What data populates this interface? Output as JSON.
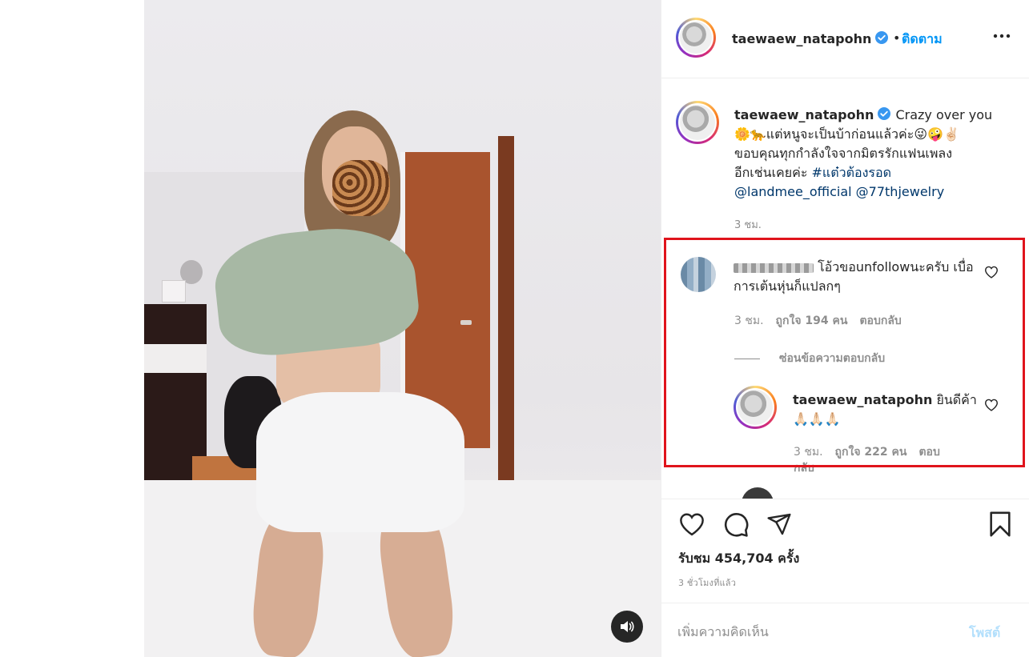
{
  "post": {
    "username": "taewaew_natapohn",
    "follow_dot": "•",
    "follow_label": "ติดตาม",
    "caption": {
      "username": "taewaew_natapohn",
      "line1": "Crazy over you",
      "line2": "🌼🐆แต่หนูจะเป็นบ้าก่อนแล้วค่ะ😜🤪✌🏻",
      "line3": "ขอบคุณทุกกำลังใจจากมิตรรักแฟนเพลง",
      "line4_text": "อีกเช่นเคยค่ะ ",
      "hashtag": "#แต๋วต้องรอด",
      "mention1": "@landmee_official",
      "mention2": "@77thjewelry",
      "time": "3 ชม."
    },
    "comment": {
      "text": " โอ้วขอunfollowนะครับ เบื่อการเต้นหุ่นก็แปลกๆ",
      "time": "3 ชม.",
      "likes": "ถูกใจ 194 คน",
      "reply_label": "ตอบกลับ"
    },
    "hide_replies_label": "ซ่อนข้อความตอบกลับ",
    "reply": {
      "username": "taewaew_natapohn",
      "text": " ยินดีค้า🙏🏻🙏🏻🙏🏻",
      "time": "3 ชม.",
      "likes": "ถูกใจ 222 คน",
      "reply_label": "ตอบกลับ"
    },
    "views": "รับชม 454,704 ครั้ง",
    "age": "3 ชั่วโมงที่แล้ว",
    "comment_placeholder": "เพิ่มความคิดเห็น",
    "post_button_label": "โพสต์"
  },
  "colors": {
    "accent": "#0095f6",
    "highlight_box": "#e0141c",
    "post_button_disabled": "#b2dffc"
  },
  "icons": {
    "header_more": "more-dots-icon",
    "verified": "verified-badge-icon",
    "sound": "speaker-icon",
    "like": "heart-icon",
    "comment": "comment-bubble-icon",
    "share": "paper-plane-icon",
    "save": "bookmark-icon"
  }
}
